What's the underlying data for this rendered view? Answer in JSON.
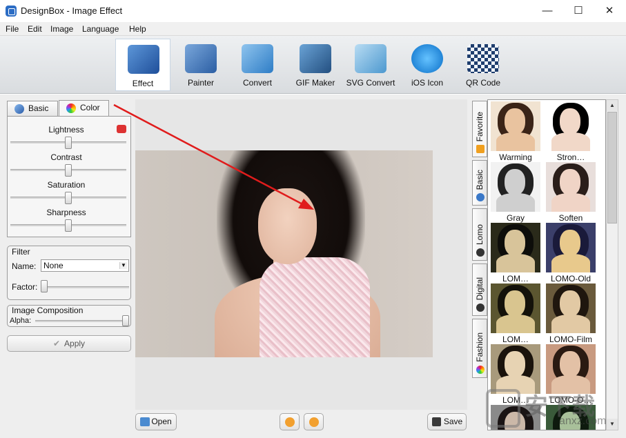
{
  "window": {
    "title": "DesignBox - Image Effect",
    "controls": {
      "minimize": "—",
      "maximize": "☐",
      "close": "✕"
    }
  },
  "menu": [
    "File",
    "Edit",
    "Image",
    "Language",
    "Help"
  ],
  "toolbar": {
    "active": "Effect",
    "tools": [
      {
        "label": "Effect",
        "icon": "feather-pen-icon",
        "color": "#3a78c8"
      },
      {
        "label": "Painter",
        "icon": "paintbrush-icon",
        "color": "#4c7fc0"
      },
      {
        "label": "Convert",
        "icon": "convert-image-icon",
        "color": "#3d8fd6"
      },
      {
        "label": "GIF Maker",
        "icon": "film-strip-icon",
        "color": "#3a76b5"
      },
      {
        "label": "SVG Convert",
        "icon": "vector-pen-icon",
        "color": "#5aa5d8"
      },
      {
        "label": "iOS Icon",
        "icon": "ios-app-icon",
        "color": "#1d8fe0"
      },
      {
        "label": "QR Code",
        "icon": "qr-code-icon",
        "color": "#3b6da8"
      }
    ]
  },
  "left_panel": {
    "tabs": [
      {
        "label": "Basic",
        "icon": "brush-icon"
      },
      {
        "label": "Color",
        "icon": "color-wheel-icon"
      }
    ],
    "active_tab": "Color",
    "adjustments": [
      {
        "label": "Lightness",
        "value": 0.5
      },
      {
        "label": "Contrast",
        "value": 0.5
      },
      {
        "label": "Saturation",
        "value": 0.5
      },
      {
        "label": "Sharpness",
        "value": 0.5
      }
    ],
    "filter": {
      "title": "Filter",
      "name_label": "Name:",
      "name_value": "None",
      "factor_label": "Factor:",
      "factor_value": 0.0
    },
    "composition": {
      "title": "Image Composition",
      "alpha_label": "Alpha:",
      "alpha_value": 1.0
    },
    "apply_label": "Apply"
  },
  "bottom_bar": {
    "open_label": "Open",
    "save_label": "Save"
  },
  "side_tabs": [
    {
      "label": "Favorite",
      "icon": "star-icon",
      "color": "#f0a020"
    },
    {
      "label": "Basic",
      "icon": "brush-icon",
      "color": "#3a78c8"
    },
    {
      "label": "Lomo",
      "icon": "camera-icon",
      "color": "#333333"
    },
    {
      "label": "Digital",
      "icon": "digital-camera-icon",
      "color": "#333333"
    },
    {
      "label": "Fashion",
      "icon": "color-wheel-icon",
      "color": "#d04040"
    }
  ],
  "effects": [
    {
      "label": "Warming",
      "tone": "#e9c39f",
      "hair": "#3b2417",
      "bg": "#f1e3d1"
    },
    {
      "label": "Stron…",
      "tone": "#f1d8c8",
      "hair": "#000000",
      "bg": "#ffffff"
    },
    {
      "label": "Gray",
      "tone": "#cfcfcf",
      "hair": "#222222",
      "bg": "#f2f2f2"
    },
    {
      "label": "Soften",
      "tone": "#f0d4c6",
      "hair": "#2a1e1a",
      "bg": "#e8dedb"
    },
    {
      "label": "LOM…",
      "tone": "#d8c49a",
      "hair": "#0d0d0a",
      "bg": "#2a2a1a"
    },
    {
      "label": "LOMO-Old",
      "tone": "#e8c98c",
      "hair": "#1a1a3a",
      "bg": "#3b3f6a"
    },
    {
      "label": "LOM…",
      "tone": "#d9c58f",
      "hair": "#14120a",
      "bg": "#5b5630"
    },
    {
      "label": "LOMO-Film",
      "tone": "#e2c9a4",
      "hair": "#1f160e",
      "bg": "#6a5a3c"
    },
    {
      "label": "LOM…",
      "tone": "#e7d3b3",
      "hair": "#1a130c",
      "bg": "#a89a7c"
    },
    {
      "label": "LOMO-O…",
      "tone": "#e3c1a6",
      "hair": "#2a1a12",
      "bg": "#c89a80"
    },
    {
      "label": "",
      "tone": "#cbb8a8",
      "hair": "#1a1414",
      "bg": "#8a8a8a"
    },
    {
      "label": "",
      "tone": "#a8c09a",
      "hair": "#0e1a0e",
      "bg": "#3a5a3a"
    }
  ],
  "watermark": {
    "text": "安下载",
    "sub": "anxz.com"
  }
}
